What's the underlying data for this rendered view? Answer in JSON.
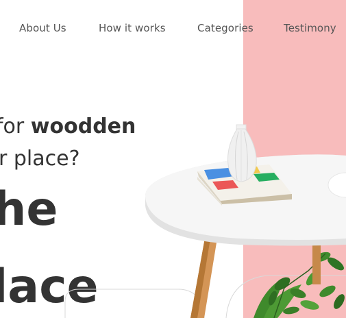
{
  "nav": {
    "items": [
      {
        "label": "About Us"
      },
      {
        "label": "How it works"
      },
      {
        "label": "Categories"
      },
      {
        "label": "Testimony"
      }
    ]
  },
  "hero": {
    "line1_lead": "for ",
    "line1_bold": "woodden",
    "line2": "r place?",
    "big1": "he",
    "big2": "lace"
  },
  "colors": {
    "accent_pink": "#f8bcbc",
    "text_dark": "#333333",
    "nav_text": "#555555"
  }
}
